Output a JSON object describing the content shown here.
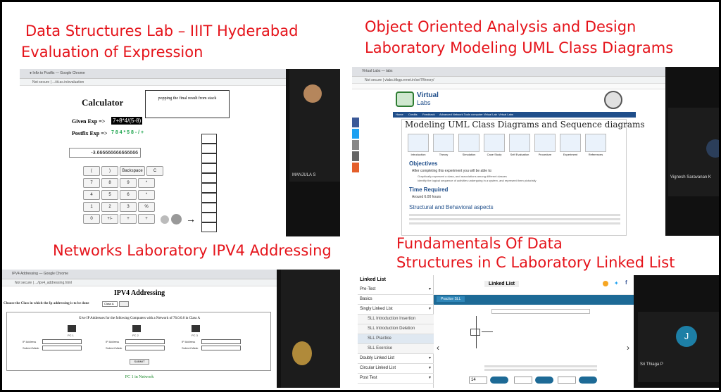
{
  "captions": {
    "tl": [
      "Data Structures Lab – IIIT Hyderabad",
      "Evaluation of Expression"
    ],
    "tr": [
      "Object Oriented Analysis and Design",
      "Laboratory Modeling UML Class Diagrams"
    ],
    "bl": "Networks Laboratory IPV4 Addressing",
    "br": [
      "Fundamentals Of Data",
      "Structures in C Laboratory  Linked List"
    ]
  },
  "calc": {
    "title": "Calculator",
    "message": "popping the final result from stack",
    "given_label": "Given Exp =>",
    "given_value": "7+8*4/(5-8)",
    "postfix_label": "Postfix Exp =>",
    "postfix_value": "7 8 4 * 5 8 - / +",
    "result": "-3.666666666666666",
    "keys": [
      "(",
      ")",
      "Backspace",
      "C",
      "7",
      "8",
      "9",
      "*",
      "4",
      "5",
      "6",
      "*",
      "1",
      "2",
      "3",
      "%",
      "0",
      "+/-",
      "+",
      "+"
    ],
    "participant": "MANJULA S"
  },
  "uml": {
    "brand": "Virtual",
    "brand2": "Labs",
    "nav": [
      "Home",
      "Credits",
      "Feedback",
      "Advanced Network Tools computer Virtual Lab",
      "Virtual Labs"
    ],
    "heading": "Modeling UML Class Diagrams and Sequence diagrams",
    "icons": [
      "Introduction",
      "Theory",
      "Simulation",
      "Case Study",
      "Self Evaluation",
      "Procedure",
      "Experiment",
      "References"
    ],
    "objectives": "Objectives",
    "obj_intro": "After completing this experiment you will be able to:",
    "obj_items": [
      "Graphically represent a class, and associations among different classes",
      "Identify the logical sequence of activities undergoing in a system, and represent them pictorially"
    ],
    "time_title": "Time Required",
    "time_value": "Around 6.00 hours",
    "aspects": "Structural and Behavioral aspects",
    "participant": "Vignesh Saravanan K"
  },
  "ipv4": {
    "title": "IPV4 Addressing",
    "choose": "Choose the Class in which the Ip addressing is to be done",
    "class_option": "Class A",
    "task": "Give IP Addresses for the following Computers with a Network of 76.0.0.0 in Class A",
    "pcs": [
      "PC 1",
      "PC 2",
      "PC 3"
    ],
    "ip_label": "IP Address",
    "mask_label": "Subnet Mask",
    "submit": "SUBMIT",
    "footer": "PC 1 in Network"
  },
  "ll": {
    "sidebar_title": "Linked List",
    "header": "Linked List",
    "tab": "Practice SLL",
    "items": [
      {
        "label": "Pre-Test",
        "sub": false,
        "chev": true
      },
      {
        "label": "Basics",
        "sub": false,
        "chev": false
      },
      {
        "label": "Singly Linked List",
        "sub": false,
        "chev": true
      },
      {
        "label": "SLL Introduction Insertion",
        "sub": true,
        "chev": false
      },
      {
        "label": "SLL Introduction Deletion",
        "sub": true,
        "chev": false
      },
      {
        "label": "SLL Practice",
        "sub": true,
        "chev": false
      },
      {
        "label": "SLL Exercise",
        "sub": true,
        "chev": false
      },
      {
        "label": "Doubly Linked List",
        "sub": false,
        "chev": true
      },
      {
        "label": "Circular Linked List",
        "sub": false,
        "chev": true
      },
      {
        "label": "Post Test",
        "sub": false,
        "chev": true
      }
    ],
    "input_value": "14",
    "participant": "Sri Thiaga P",
    "avatar_letter": "J"
  },
  "colors": {
    "caption": "#e5131a",
    "vlab_blue": "#1f4e8a",
    "ll_blue": "#1d6a96"
  }
}
